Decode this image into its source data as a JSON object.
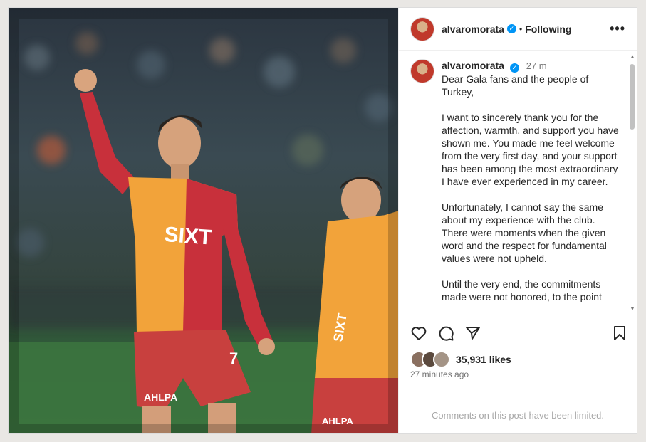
{
  "post": {
    "username": "alvaromorata",
    "verified_symbol": "✓",
    "separator": "•",
    "follow_status": "Following",
    "more_symbol": "•••"
  },
  "caption": {
    "username": "alvaromorata",
    "time": "27 m",
    "paragraphs": [
      "Dear Gala fans and the people of Turkey,",
      "I want to sincerely thank you for the affection, warmth, and support you have shown me. You made me feel welcome from the very first day, and your support has been among the most extraordinary I have ever experienced in my career.",
      "Unfortunately, I cannot say the same about my experience with the club. There were moments when the given word and the respect for fundamental values were not upheld.",
      "Until the very end, the commitments made were not honored, to the point"
    ]
  },
  "engagement": {
    "likes": "35,931 likes",
    "posted_ago": "27 minutes ago"
  },
  "footer": {
    "comments_notice": "Comments on this post have been limited."
  },
  "photo": {
    "sponsor_text": "SIXT",
    "shorts_text": "AHLPA",
    "number": "7"
  },
  "icons": [
    "heart-icon",
    "comment-icon",
    "share-icon",
    "bookmark-icon",
    "verified-icon",
    "more-icon"
  ],
  "colors": {
    "accent": "#0095f6",
    "jersey_orange": "#f2a33a",
    "jersey_red": "#c8303b"
  }
}
